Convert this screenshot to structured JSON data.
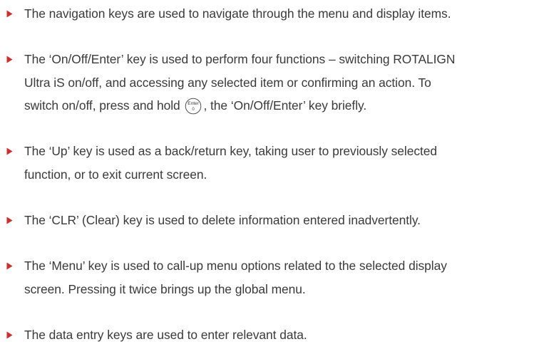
{
  "colors": {
    "bullet": "#d22b2b",
    "text": "#3a3a3a"
  },
  "icons": {
    "bullet": "triangle-right-icon",
    "enter_key": "enter-key-icon"
  },
  "items": [
    {
      "lines": [
        "The navigation keys are used to navigate through the menu and display items."
      ]
    },
    {
      "lines": [
        "The ‘On/Off/Enter’ key is used to perform four functions – switching ROTALIGN",
        "Ultra iS on/off, and accessing any selected item or confirming an action. To"
      ],
      "line3_before": "switch on/off, press and hold",
      "line3_after": ", the ‘On/Off/Enter’ key briefly.",
      "key_label_top": "Enter",
      "key_label_bottom": "0"
    },
    {
      "lines": [
        "The ‘Up’ key is used as a back/return key, taking user to previously selected",
        "function, or to exit current screen."
      ]
    },
    {
      "lines": [
        "The ‘CLR’ (Clear) key is used to delete information entered inadvertently."
      ]
    },
    {
      "lines": [
        "The ‘Menu’ key is used to call-up menu options related to the selected display",
        "screen. Pressing it twice brings up the global menu."
      ]
    },
    {
      "lines": [
        "The data entry keys are used to enter relevant data."
      ]
    }
  ]
}
